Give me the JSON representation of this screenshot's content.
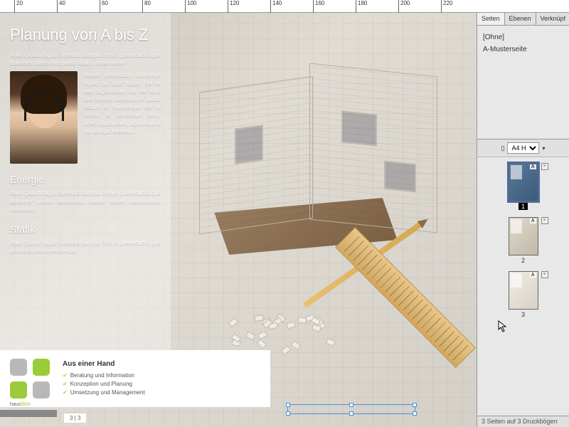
{
  "ruler": {
    "marks": [
      20,
      40,
      60,
      80,
      100,
      120,
      140,
      160,
      180,
      200,
      220
    ]
  },
  "doc": {
    "title": "Planung von A bis Z",
    "intro": "Aliko Quiam fugia consedis sumqui omnis queendunto que doloreris utenis excepedio maion nonet vente-",
    "col_text": "meade delendam, quidempe reped qui odic totae. Pel et vent fugitatecum, siti res reria cus nestent urendam et quisto occullit et maionsequi tent ut volore, si nonestium dolu. Unen, quidipsam, ulpa dolut ut ma dolupic laesequi.",
    "h2a": "Energie",
    "p2": "Aliko Quiam fugia consedis sumqui omnis queendunto que doloreris utenis excepedio maion nonet ventemeade delendam.",
    "h2b": "Statik",
    "p3": "Aliko Quiam fugia consedis sumqui omnis queendunto que doloreris utenis excepedio."
  },
  "footer": {
    "brand_a": "haus",
    "brand_b": "fiktiv",
    "heading": "Aus einer Hand",
    "items": [
      "Beratung und Information",
      "Konzeption und Planung",
      "Umsetzung und Management"
    ],
    "page": "3 | 3"
  },
  "panel": {
    "tabs": [
      "Seiten",
      "Ebenen",
      "Verknüpf"
    ],
    "masters": [
      "[Ohne]",
      "A-Musterseite"
    ],
    "size_label": "A4 H",
    "pages": [
      {
        "num": "1",
        "letter": "A",
        "selected": true,
        "bg": "bg1"
      },
      {
        "num": "2",
        "letter": "A",
        "selected": false,
        "bg": "bg2"
      },
      {
        "num": "3",
        "letter": "A",
        "selected": false,
        "bg": "bg3"
      }
    ],
    "status": "3 Seiten auf 3 Druckbögen"
  }
}
